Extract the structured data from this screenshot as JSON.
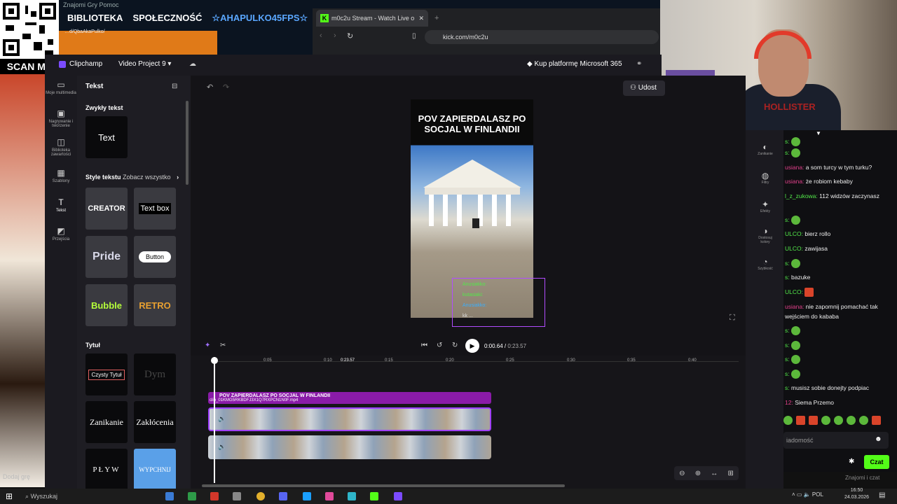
{
  "overlay": {
    "scan_me": "SCAN ME",
    "top_menu": "Znajomi  Gry  Pomoc",
    "nav": [
      "BIBLIOTEKA",
      "SPOŁECZNOŚĆ",
      "☆AHAPULKO45FPS☆"
    ],
    "banner_url": "…d/QbaAkaPulko/",
    "add_game": "Dodaj grę"
  },
  "browser": {
    "tab_title": "m0c2u Stream - Watch Live o",
    "url": "kick.com/m0c2u"
  },
  "webcam": {
    "shirt_text": "HOLLISTER"
  },
  "clipchamp": {
    "logo": "Clipchamp",
    "project": "Video Project 9",
    "buy_ms": "Kup platformę Microsoft 365",
    "share": "Udost",
    "rail": [
      {
        "icon": "folder-icon",
        "label": "Moje multimedia"
      },
      {
        "icon": "camera-icon",
        "label": "Nagrywanie i tworzenie"
      },
      {
        "icon": "library-icon",
        "label": "Biblioteka zawartości"
      },
      {
        "icon": "templates-icon",
        "label": "Szablony"
      },
      {
        "icon": "text-icon",
        "label": "Tekst"
      },
      {
        "icon": "transitions-icon",
        "label": "Przejścia"
      }
    ],
    "panel": {
      "title": "Tekst",
      "plain_text_section": "Zwykły tekst",
      "plain_text_tile": "Text",
      "styles_section": "Style tekstu",
      "see_all": "Zobacz wszystko",
      "style_tiles": [
        "CREATOR",
        "Text box",
        "Pride",
        "Button",
        "Bubble",
        "RETRO"
      ],
      "title_section": "Tytuł",
      "title_tiles": [
        "Czysty Tytuł",
        "Dym",
        "Zanikanie",
        "Zakłócenia",
        "PŁYW",
        "WYPCHNIJ"
      ]
    },
    "video_title": "POV ZAPIERDALASZ PO SOCJAL W FINLANDII",
    "video_chat_overlay": [
      "Anusiakko:",
      "kutasiaki:",
      "Anusiakko:",
      "kk  ..."
    ],
    "right_rail": [
      "Zanikanie",
      "Filtry",
      "Efekty",
      "Dostosuj kolory",
      "Szybkość"
    ],
    "playback": {
      "current": "0:00.64",
      "total": "0:23.57"
    },
    "ticks": [
      "0:05",
      "0:10",
      "0:23.57",
      "0:15",
      "0:20",
      "0:25",
      "0:30",
      "0:35",
      "0:40"
    ],
    "text_track": "POV ZAPIERDALASZ PO SOCJAL W FINLANDII",
    "clip_name": "clip_01KMG5RKBDFJ3X1Q7RXPCN1N0F.mp4"
  },
  "chat": {
    "messages": [
      {
        "user": "s:",
        "text": "",
        "emote": true
      },
      {
        "user": "s:",
        "text": "",
        "emote": true
      },
      {
        "user": "usiana:",
        "text": "a som turcy w tym turku?"
      },
      {
        "user": "usiana:",
        "text": "że robiom kebaby"
      },
      {
        "user": "l_z_zukowa:",
        "text": "112 widzów zaczynasz"
      },
      {
        "user": "s:",
        "text": "",
        "emote": true
      },
      {
        "user": "ULCO:",
        "text": "bierz rollo"
      },
      {
        "user": "ULCO:",
        "text": "zawijasa"
      },
      {
        "user": "s:",
        "text": "",
        "emote": true
      },
      {
        "user": "s:",
        "text": "bazuke"
      },
      {
        "user": "ULCO:",
        "text": "",
        "emote": true
      },
      {
        "user": "usiana:",
        "text": "nie zapomnij pomachać tak"
      },
      {
        "user": "",
        "text": "wejściem do kababa"
      },
      {
        "user": "s:",
        "text": "",
        "emote": true
      },
      {
        "user": "s:",
        "text": "",
        "emote": true
      },
      {
        "user": "s:",
        "text": "",
        "emote": true
      },
      {
        "user": "s:",
        "text": "",
        "emote": true
      },
      {
        "user": "s:",
        "text": "musisz sobie donejty podpiac"
      },
      {
        "user": "12:",
        "text": "Siema Przemo"
      }
    ],
    "input_placeholder": "iadomość",
    "send": "Czat",
    "friends": "Znajomi i czat"
  },
  "taskbar": {
    "search": "Wyszukaj",
    "lang": "POL",
    "time": "16:50",
    "date": "24.03.2026"
  }
}
